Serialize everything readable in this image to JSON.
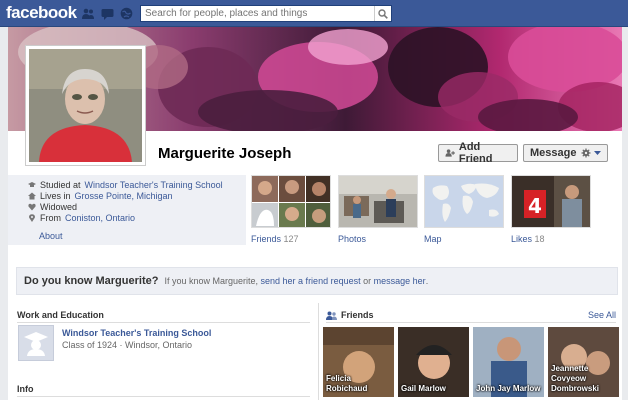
{
  "topbar": {
    "logo": "facebook",
    "search_placeholder": "Search for people, places and things",
    "jewels": [
      "friend-requests-icon",
      "messages-icon",
      "notifications-icon"
    ]
  },
  "profile": {
    "name": "Marguerite Joseph",
    "add_friend": "Add Friend",
    "message": "Message"
  },
  "info": {
    "studied": "Studied at",
    "studied_place": "Windsor Teacher's Training School",
    "lives": "Lives in",
    "lives_place": "Grosse Pointe, Michigan",
    "status": "Widowed",
    "from": "From",
    "from_place": "Coniston, Ontario",
    "about": "About"
  },
  "tiles": {
    "friends_label": "Friends",
    "friends_count": "127",
    "photos_label": "Photos",
    "map_label": "Map",
    "likes_label": "Likes",
    "likes_count": "18"
  },
  "dyk": {
    "title": "Do you know Marguerite?",
    "text1": "If you know Marguerite,",
    "link1": "send her a friend request",
    "text2": "or",
    "link2": "message her",
    "text3": "."
  },
  "work": {
    "title": "Work and Education",
    "school": "Windsor Teacher's Training School",
    "detail": "Class of 1924 · Windsor, Ontario"
  },
  "info_section": {
    "title": "Info"
  },
  "friends_section": {
    "title": "Friends",
    "see_all": "See All",
    "people": [
      {
        "name": "Felicia Robichaud"
      },
      {
        "name": "Gail Marlow"
      },
      {
        "name": "John Jay Marlow"
      },
      {
        "name": "Jeannette Covyeow Dombrowski"
      }
    ]
  },
  "colors": {
    "brand": "#3b5998",
    "panel": "#eef0f5"
  }
}
